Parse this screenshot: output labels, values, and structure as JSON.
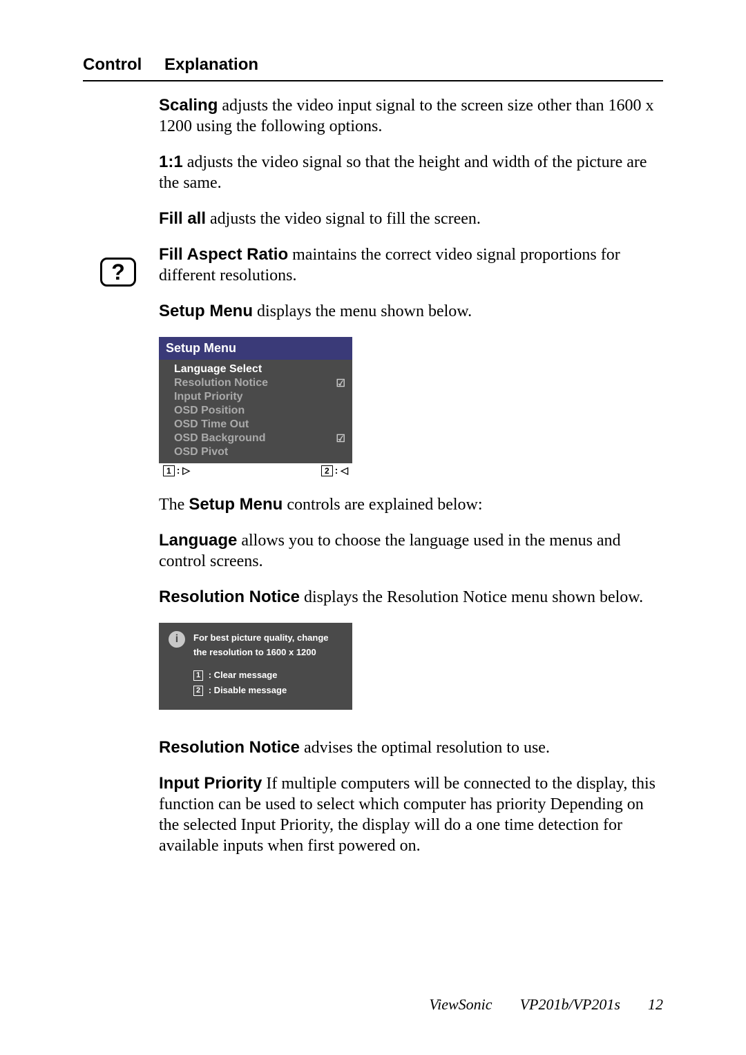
{
  "header": {
    "col1": "Control",
    "col2": "Explanation"
  },
  "scaling": {
    "term": "Scaling",
    "text": " adjusts the video input signal to the screen size other than 1600 x 1200 using the following options."
  },
  "one_one": {
    "term": "1:1",
    "text": " adjusts the video signal so that the height and width of the picture are the same."
  },
  "fill_all": {
    "term": "Fill all",
    "text": " adjusts the video signal to fill the screen."
  },
  "fill_aspect": {
    "term": "Fill Aspect Ratio",
    "text": " maintains the correct video signal proportions for different resolutions."
  },
  "setup_intro": {
    "term": "Setup Menu",
    "text": " displays the menu shown below."
  },
  "qmark": "?",
  "osd": {
    "title": "Setup Menu",
    "items": [
      {
        "label": "Language Select",
        "active": true,
        "check": false
      },
      {
        "label": "Resolution Notice",
        "active": false,
        "check": true
      },
      {
        "label": "Input Priority",
        "active": false,
        "check": false
      },
      {
        "label": "OSD Position",
        "active": false,
        "check": false
      },
      {
        "label": "OSD Time Out",
        "active": false,
        "check": false
      },
      {
        "label": "OSD Background",
        "active": false,
        "check": true
      },
      {
        "label": "OSD Pivot",
        "active": false,
        "check": false
      }
    ],
    "foot_left_key": "1",
    "foot_left_sym": ": ▷",
    "foot_right_key": "2",
    "foot_right_sym": ": ◁"
  },
  "after_setup": {
    "pre": "The ",
    "term": "Setup Menu",
    "post": " controls are explained below:"
  },
  "language": {
    "term": "Language",
    "text": " allows you to choose the language used in the menus and control screens."
  },
  "res_notice_intro": {
    "term": "Resolution Notice",
    "text": " displays the Resolution Notice menu shown below."
  },
  "notice": {
    "info_glyph": "i",
    "msg_line1": "For best picture quality, change",
    "msg_line2": "the resolution to 1600 x 1200",
    "opt1_key": "1",
    "opt1_label": " : Clear message",
    "opt2_key": "2",
    "opt2_label": " : Disable message"
  },
  "res_notice_expl": {
    "term": "Resolution Notice",
    "text": " advises the optimal resolution to use."
  },
  "input_priority": {
    "term": "Input Priority",
    "text": " If multiple computers will be connected to the display, this function can be used to select which computer has priority Depending on the selected Input Priority, the display will do a one time detection for available inputs when first powered on."
  },
  "footer": {
    "brand": "ViewSonic",
    "model": "VP201b/VP201s",
    "page": "12"
  }
}
